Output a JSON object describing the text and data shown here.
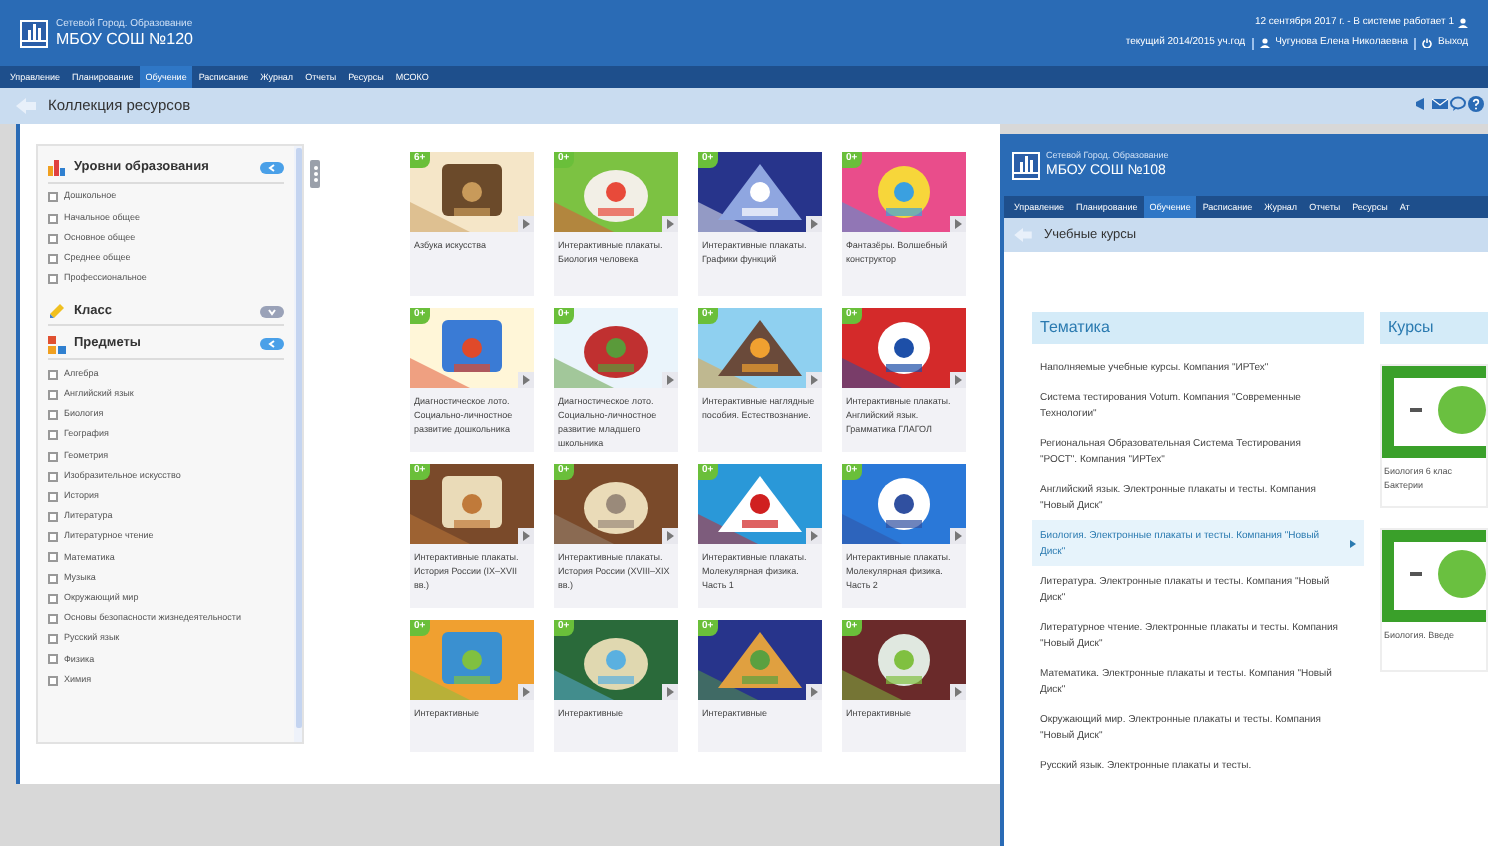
{
  "header": {
    "brand": "Сетевой Город. Образование",
    "school": "МБОУ СОШ №120",
    "date_line": "12 сентября 2017 г. - В системе работает 1",
    "year": "текущий 2014/2015 уч.год",
    "user": "Чугунова Елена Николаевна",
    "logout": "Выход"
  },
  "nav": [
    {
      "label": "Управление",
      "selected": false
    },
    {
      "label": "Планирование",
      "selected": false
    },
    {
      "label": "Обучение",
      "selected": true
    },
    {
      "label": "Расписание",
      "selected": false
    },
    {
      "label": "Журнал",
      "selected": false
    },
    {
      "label": "Отчеты",
      "selected": false
    },
    {
      "label": "Ресурсы",
      "selected": false
    },
    {
      "label": "МСОКО",
      "selected": false
    }
  ],
  "page_title": "Коллекция ресурсов",
  "filters": [
    {
      "title": "Уровни образования",
      "expanded": true,
      "items": [
        {
          "label": "Дошкольное",
          "checked": false
        },
        {
          "label": "Начальное общее",
          "checked": false
        },
        {
          "label": "Основное общее",
          "checked": false
        },
        {
          "label": "Среднее общее",
          "checked": false
        },
        {
          "label": "Профессиональное",
          "checked": false
        }
      ]
    },
    {
      "title": "Класс",
      "expanded": false
    },
    {
      "title": "Предметы",
      "expanded": true,
      "items": [
        {
          "label": "Алгебра",
          "checked": false
        },
        {
          "label": "Английский язык",
          "checked": false
        },
        {
          "label": "Биология",
          "checked": false
        },
        {
          "label": "География",
          "checked": false
        },
        {
          "label": "Геометрия",
          "checked": false
        },
        {
          "label": "Изобразительное искусство",
          "checked": false
        },
        {
          "label": "История",
          "checked": false
        },
        {
          "label": "Литература",
          "checked": false
        },
        {
          "label": "Литературное чтение",
          "checked": false
        },
        {
          "label": "Математика",
          "checked": false
        },
        {
          "label": "Музыка",
          "checked": false
        },
        {
          "label": "Окружающий мир",
          "checked": false
        },
        {
          "label": "Основы безопасности жизнедеятельности",
          "checked": false
        },
        {
          "label": "Русский язык",
          "checked": false
        },
        {
          "label": "Физика",
          "checked": false
        },
        {
          "label": "Химия",
          "checked": false
        }
      ]
    }
  ],
  "resources": [
    {
      "age": "6+",
      "title": "Азбука искусства"
    },
    {
      "age": "0+",
      "title": "Интерактивные плакаты. Биология человека"
    },
    {
      "age": "0+",
      "title": "Интерактивные плакаты. Графики функций"
    },
    {
      "age": "0+",
      "title": "Фантазёры. Волшебный конструктор"
    },
    {
      "age": "0+",
      "title": "Диагностическое лото. Социально-личностное развитие дошкольника"
    },
    {
      "age": "0+",
      "title": "Диагностическое лото. Социально-личностное развитие младшего школьника"
    },
    {
      "age": "0+",
      "title": "Интерактивные наглядные пособия. Естествознание."
    },
    {
      "age": "0+",
      "title": "Интерактивные плакаты. Английский язык. Грамматика ГЛАГОЛ"
    },
    {
      "age": "0+",
      "title": "Интерактивные плакаты. История России (IX–XVII вв.)"
    },
    {
      "age": "0+",
      "title": "Интерактивные плакаты. История России (XVIII–XIX вв.)"
    },
    {
      "age": "0+",
      "title": "Интерактивные плакаты. Молекулярная физика. Часть 1"
    },
    {
      "age": "0+",
      "title": "Интерактивные плакаты. Молекулярная физика. Часть 2"
    },
    {
      "age": "0+",
      "title": "Интерактивные"
    },
    {
      "age": "0+",
      "title": "Интерактивные"
    },
    {
      "age": "0+",
      "title": "Интерактивные"
    },
    {
      "age": "0+",
      "title": "Интерактивные"
    }
  ],
  "overlay": {
    "brand": "Сетевой Город. Образование",
    "school": "МБОУ СОШ №108",
    "nav": [
      {
        "label": "Управление",
        "selected": false
      },
      {
        "label": "Планирование",
        "selected": false
      },
      {
        "label": "Обучение",
        "selected": true
      },
      {
        "label": "Расписание",
        "selected": false
      },
      {
        "label": "Журнал",
        "selected": false
      },
      {
        "label": "Отчеты",
        "selected": false
      },
      {
        "label": "Ресурсы",
        "selected": false
      },
      {
        "label": "Ат",
        "selected": false
      }
    ],
    "page_title": "Учебные курсы",
    "topics_title": "Тематика",
    "topics": [
      {
        "label": "Наполняемые учебные курсы. Компания \"ИРТех\"",
        "selected": false
      },
      {
        "label": "Система тестирования Votum. Компания \"Современные Технологии\"",
        "selected": false
      },
      {
        "label": "Региональная Образовательная Система Тестирования \"РОСТ\". Компания \"ИРТех\"",
        "selected": false
      },
      {
        "label": "Английский язык. Электронные плакаты и тесты. Компания \"Новый Диск\"",
        "selected": false
      },
      {
        "label": "Биология. Электронные плакаты и тесты. Компания \"Новый Диск\"",
        "selected": true
      },
      {
        "label": "Литература. Электронные плакаты и тесты. Компания \"Новый Диск\"",
        "selected": false
      },
      {
        "label": "Литературное чтение. Электронные плакаты и тесты. Компания \"Новый Диск\"",
        "selected": false
      },
      {
        "label": "Математика. Электронные плакаты и тесты. Компания \"Новый Диск\"",
        "selected": false
      },
      {
        "label": "Окружающий мир. Электронные плакаты и тесты. Компания \"Новый Диск\"",
        "selected": false
      },
      {
        "label": "Русский язык. Электронные плакаты и тесты.",
        "selected": false
      }
    ],
    "courses_title": "Курсы",
    "courses": [
      {
        "title": "Биология 6 клас",
        "subtitle": "Бактерии"
      },
      {
        "title": "Биология. Введе"
      }
    ]
  }
}
